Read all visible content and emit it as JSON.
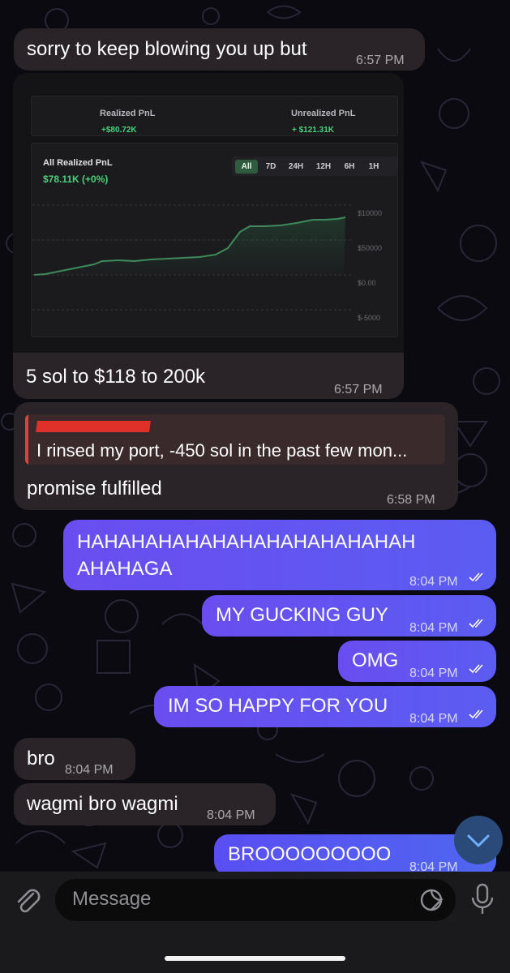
{
  "conversation": {
    "messages": [
      {
        "text": "sorry to keep blowing you up but",
        "time": "6:57 PM"
      },
      {
        "caption": "5 sol to $118 to 200k",
        "time": "6:57 PM"
      },
      {
        "reply_quote": "I rinsed my port, -450 sol in the past few mon...",
        "text": "promise fulfilled",
        "time": "6:58 PM"
      },
      {
        "line1": "HAHAHAHAHAHAHAHAHAHAHAHAH",
        "line2": "AHAHAGA",
        "time": "8:04 PM"
      },
      {
        "text": "MY GUCKING GUY",
        "time": "8:04 PM"
      },
      {
        "text": "OMG",
        "time": "8:04 PM"
      },
      {
        "text": "IM SO HAPPY FOR YOU",
        "time": "8:04 PM"
      },
      {
        "text": "bro",
        "time": "8:04 PM"
      },
      {
        "text": "wagmi bro wagmi",
        "time": "8:04 PM"
      },
      {
        "text": "BROOOOOOOOO",
        "time": "8:04 PM"
      }
    ]
  },
  "pnl_image": {
    "realized_label": "Realized PnL",
    "realized_value": "+$80.72K",
    "unrealized_label": "Unrealized PnL",
    "unrealized_value": "+ $121.31K",
    "all_label": "All Realized PnL",
    "all_value": "$78.11K (+0%)",
    "timeframes": [
      "All",
      "7D",
      "24H",
      "12H",
      "6H",
      "1H"
    ],
    "active_timeframe": "All",
    "y_axis": [
      "$10000",
      "$50000",
      "$0.00",
      "$-5000"
    ],
    "accent_green": "#49d17c"
  },
  "input": {
    "placeholder": "Message",
    "attach_icon": "paperclip-icon",
    "sticker_icon": "sticker-icon",
    "mic_icon": "microphone-icon"
  },
  "colors": {
    "outgoing_bubble": "#6a4df0",
    "incoming_bubble": "#2a2428",
    "background": "#0b0a10"
  }
}
